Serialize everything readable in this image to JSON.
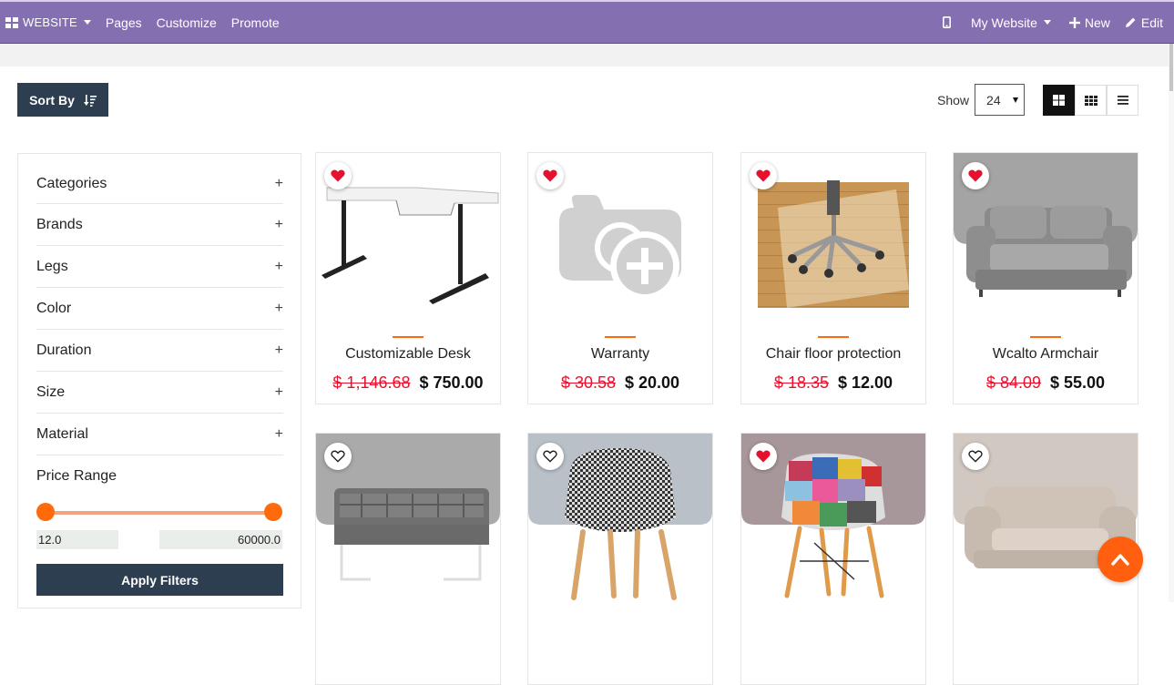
{
  "topbar": {
    "brand": "WEBSITE",
    "menu": [
      "Pages",
      "Customize",
      "Promote"
    ],
    "website_selector": "My Website",
    "new_label": "New",
    "edit_label": "Edit"
  },
  "toolbar": {
    "sort_label": "Sort By",
    "show_label": "Show",
    "show_value": "24",
    "views": [
      "grid-large-icon",
      "grid-small-icon",
      "list-icon"
    ],
    "active_view": "grid-large-icon"
  },
  "sidebar": {
    "filters": [
      "Categories",
      "Brands",
      "Legs",
      "Color",
      "Duration",
      "Size",
      "Material"
    ],
    "expand_symbol": "+",
    "price_range": {
      "title": "Price Range",
      "min": "12.0",
      "max": "60000.0"
    },
    "apply_label": "Apply Filters"
  },
  "products": [
    {
      "name": "Customizable Desk",
      "old_price": "$ 1,146.68",
      "price": "$ 750.00",
      "wishlisted": true,
      "image": "desk"
    },
    {
      "name": "Warranty",
      "old_price": "$ 30.58",
      "price": "$ 20.00",
      "wishlisted": true,
      "image": "placeholder-camera"
    },
    {
      "name": "Chair floor protection",
      "old_price": "$ 18.35",
      "price": "$ 12.00",
      "wishlisted": true,
      "image": "floor-mat"
    },
    {
      "name": "Wcalto Armchair",
      "old_price": "$ 84.09",
      "price": "$ 55.00",
      "wishlisted": true,
      "image": "grey-sofa"
    },
    {
      "name": "",
      "old_price": "",
      "price": "",
      "wishlisted": false,
      "image": "quilted-sofa"
    },
    {
      "name": "",
      "old_price": "",
      "price": "",
      "wishlisted": false,
      "image": "houndstooth-chair"
    },
    {
      "name": "",
      "old_price": "",
      "price": "",
      "wishlisted": true,
      "image": "patchwork-chair"
    },
    {
      "name": "",
      "old_price": "",
      "price": "",
      "wishlisted": false,
      "image": "beige-sofa"
    }
  ],
  "colors": {
    "admin_bar": "#8470b0",
    "dark_button": "#2c3e50",
    "accent_orange": "#ff6b0b",
    "sale_red": "#e8112d",
    "heart_red": "#e8112d"
  }
}
